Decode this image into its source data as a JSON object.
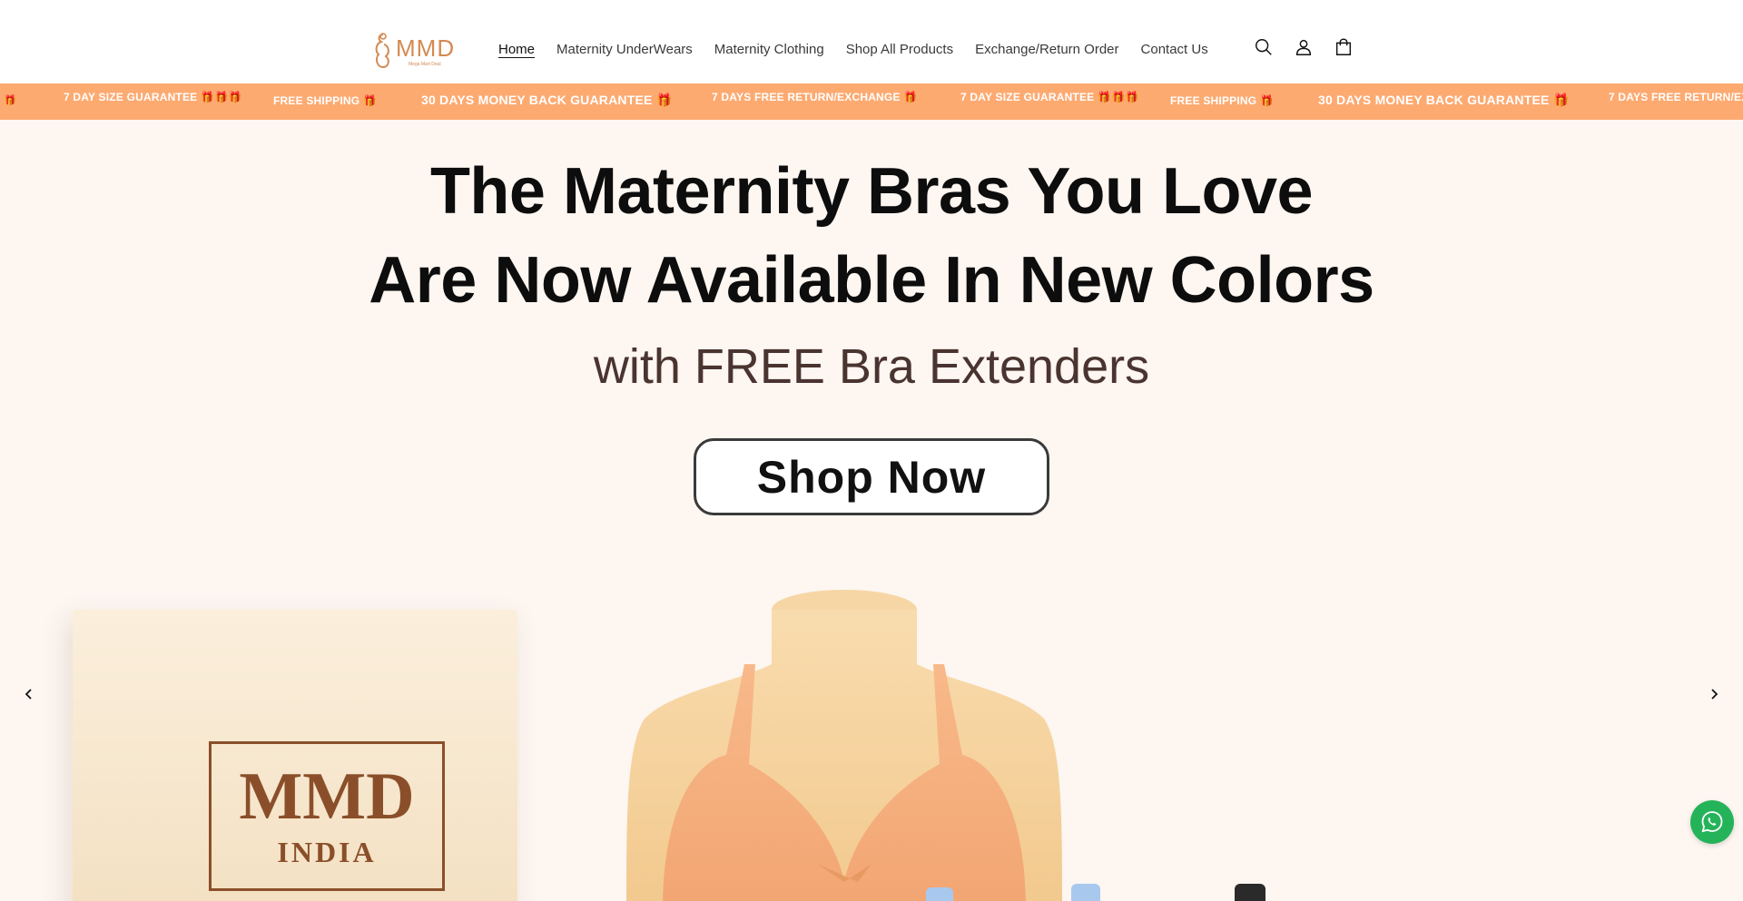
{
  "brand": {
    "logo_text": "MMD",
    "logo_tagline": "Mega Mart Deal",
    "brand_color": "#d48a52"
  },
  "nav": {
    "items": [
      {
        "label": "Home",
        "active": true
      },
      {
        "label": "Maternity UnderWears",
        "active": false
      },
      {
        "label": "Maternity Clothing",
        "active": false
      },
      {
        "label": "Shop All Products",
        "active": false
      },
      {
        "label": "Exchange/Return Order",
        "active": false
      },
      {
        "label": "Contact Us",
        "active": false
      }
    ]
  },
  "header_icons": [
    "search-icon",
    "account-icon",
    "cart-icon"
  ],
  "marquee": {
    "background": "#fdaa71",
    "items": [
      {
        "text": "🎁"
      },
      {
        "text": "7 DAY SIZE GUARANTEE 🎁🎁🎁"
      },
      {
        "text": "FREE SHIPPING 🎁"
      },
      {
        "text": "30 DAYS MONEY BACK GUARANTEE 🎁"
      },
      {
        "text": "7 DAYS FREE RETURN/EXCHANGE 🎁"
      },
      {
        "text": "7 DAY SIZE GUARANTEE 🎁🎁🎁"
      },
      {
        "text": "FREE SHIPPING 🎁"
      },
      {
        "text": "30 DAYS MONEY BACK GUARANTEE 🎁"
      },
      {
        "text": "7 DAYS FREE RETURN/EX"
      }
    ]
  },
  "hero": {
    "headline_line1": "The Maternity Bras You Love",
    "headline_line2": "Are Now Available In New Colors",
    "subheadline": "with FREE Bra Extenders",
    "cta_label": "Shop Now",
    "box_brand": "MMD",
    "box_sub": "INDIA",
    "background": "#fdf6f1"
  },
  "slideshow": {
    "prev_icon": "chevron-left-icon",
    "next_icon": "chevron-right-icon"
  },
  "whatsapp": {
    "icon": "whatsapp-icon",
    "color": "#25b35a"
  }
}
